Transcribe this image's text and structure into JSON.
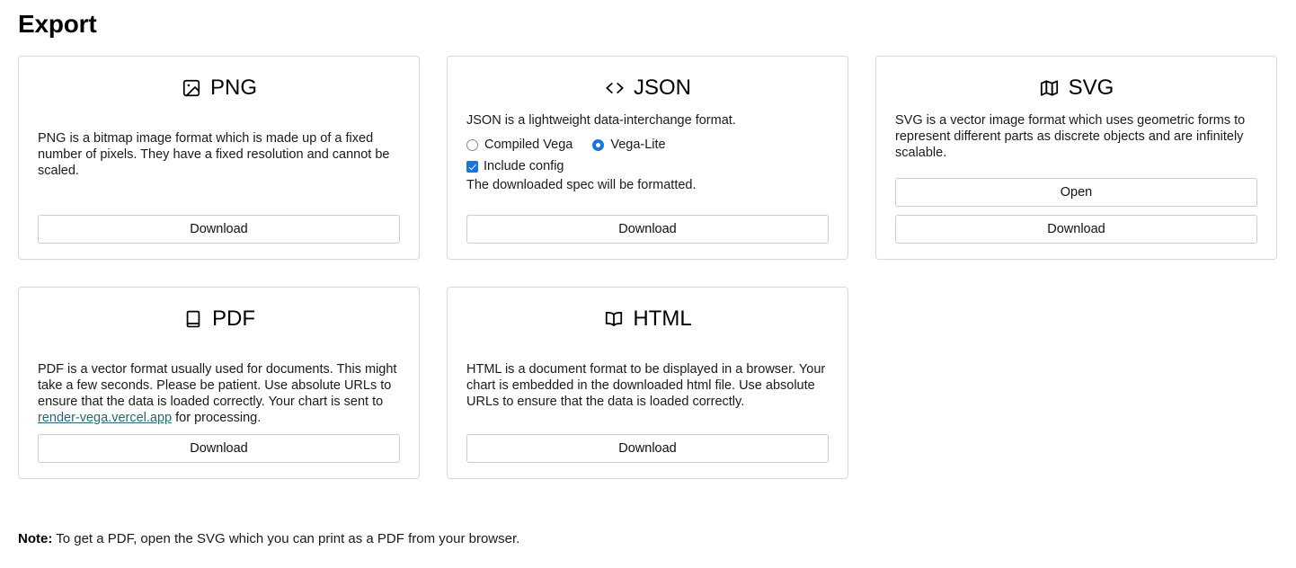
{
  "page": {
    "title": "Export",
    "note_label": "Note:",
    "note_text": " To get a PDF, open the SVG which you can print as a PDF from your browser."
  },
  "colors": {
    "accent": "#1675e0",
    "card_border": "#d8d8d8",
    "button_border": "#cccccc",
    "link": "#2b6372",
    "text": "#1a1a1a"
  },
  "cards": {
    "png": {
      "icon": "image-icon",
      "title": "PNG",
      "description": "PNG is a bitmap image format which is made up of a fixed number of pixels. They have a fixed resolution and cannot be scaled.",
      "download_label": "Download"
    },
    "json": {
      "icon": "code-brackets-icon",
      "title": "JSON",
      "description": "JSON is a lightweight data-interchange format.",
      "radio_options": [
        {
          "label": "Compiled Vega",
          "selected": false
        },
        {
          "label": "Vega-Lite",
          "selected": true
        }
      ],
      "checkbox": {
        "label": "Include config",
        "checked": true
      },
      "hint": "The downloaded spec will be formatted.",
      "download_label": "Download"
    },
    "svg": {
      "icon": "map-icon",
      "title": "SVG",
      "description": "SVG is a vector image format which uses geometric forms to represent different parts as discrete objects and are infinitely scalable.",
      "open_label": "Open",
      "download_label": "Download"
    },
    "pdf": {
      "icon": "book-closed-icon",
      "title": "PDF",
      "description_before": "PDF is a vector format usually used for documents. This might take a few seconds. Please be patient. Use absolute URLs to ensure that the data is loaded correctly. Your chart is sent to ",
      "link_text": "render-vega.vercel.app",
      "description_after": " for processing.",
      "download_label": "Download"
    },
    "html": {
      "icon": "book-open-icon",
      "title": "HTML",
      "description": "HTML is a document format to be displayed in a browser. Your chart is embedded in the downloaded html file. Use absolute URLs to ensure that the data is loaded correctly.",
      "download_label": "Download"
    }
  }
}
